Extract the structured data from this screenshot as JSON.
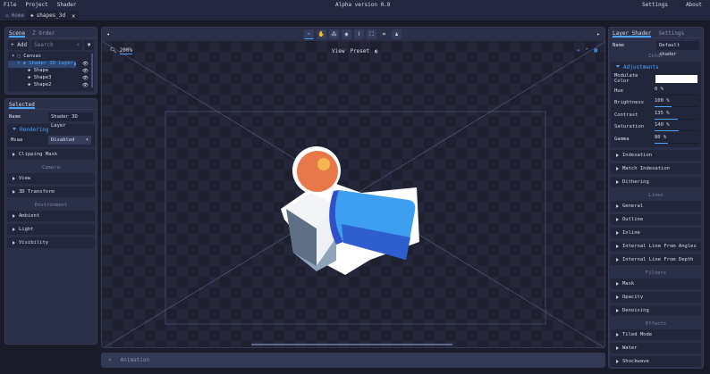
{
  "menu": {
    "items": [
      "File",
      "Project",
      "Shader"
    ],
    "title": "Alpha version 0.8",
    "right": [
      "Settings",
      "About"
    ]
  },
  "tabs": {
    "home": "Home",
    "file": "shapes_3d"
  },
  "scene": {
    "tabs": [
      "Scene",
      "Z Order"
    ],
    "add": "+ Add",
    "search_placeholder": "Search",
    "tree": [
      {
        "label": "Canvas"
      },
      {
        "label": "Shader 3D Layer"
      },
      {
        "label": "Shape"
      },
      {
        "label": "Shape3"
      },
      {
        "label": "Shape2"
      }
    ]
  },
  "selected": {
    "tab": "Selected",
    "name_label": "Name",
    "name_value": "Shader 3D Layer",
    "rendering": "Rendering",
    "msaa_label": "Msaa",
    "msaa_value": "Disabled",
    "clipping": "Clipping Mask",
    "camera": "Camera",
    "view": "View",
    "transform": "3D Transform",
    "environment": "Environment",
    "ambient": "Ambient",
    "light": "Light",
    "visibility": "Visibility"
  },
  "viewport": {
    "zoom": "200%",
    "view": "View",
    "preset": "Preset"
  },
  "animation": {
    "label": "Animation"
  },
  "right": {
    "tabs": [
      "Layer Shader",
      "Settings"
    ],
    "name_label": "Name",
    "name_value": "Default shader",
    "color": "Color",
    "adjustments": "Adjustments",
    "modulate_label": "Modulate Color",
    "modulate_color": "#ffffff",
    "sliders": [
      {
        "label": "Hue",
        "value": "0 %",
        "fraction": 0
      },
      {
        "label": "Brightness",
        "value": "100 %",
        "fraction": 0.4
      },
      {
        "label": "Contrast",
        "value": "135 %",
        "fraction": 0.54
      },
      {
        "label": "Saturation",
        "value": "140 %",
        "fraction": 0.56
      },
      {
        "label": "Gamma",
        "value": "80 %",
        "fraction": 0.32
      }
    ],
    "groups1": [
      "Indexation",
      "Match Indexation",
      "Dithering"
    ],
    "lines": "Lines",
    "groups2": [
      "General",
      "Outline",
      "Inline",
      "Internal Line From Angles",
      "Internal Line From Depth"
    ],
    "filters": "Filters",
    "groups3": [
      "Mask",
      "Opacity",
      "Denoising"
    ],
    "effects": "Effects",
    "groups4": [
      "Tiled Mode",
      "Water",
      "Shockwave"
    ]
  },
  "colors": {
    "accent": "#4aa3ff"
  }
}
